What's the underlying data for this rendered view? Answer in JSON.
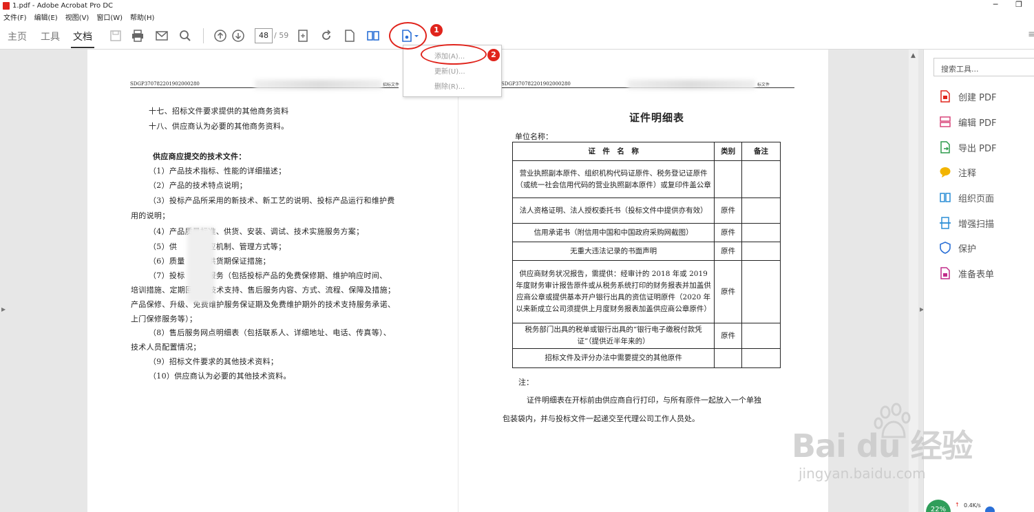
{
  "window": {
    "title": "1.pdf - Adobe Acrobat Pro DC",
    "minimize": "─",
    "restore": "❐"
  },
  "menu": [
    "文件(F)",
    "编辑(E)",
    "视图(V)",
    "窗口(W)",
    "帮助(H)"
  ],
  "tabs": {
    "home": "主页",
    "tools": "工具",
    "document": "文档"
  },
  "toolbar": {
    "page_current": "48",
    "page_total": "/ 59",
    "icons": [
      "save-icon",
      "print-icon",
      "email-icon",
      "search-icon",
      "page-up-icon",
      "page-down-icon",
      "fit-page-icon",
      "rotate-icon",
      "single-page-icon",
      "two-page-icon",
      "bookmark-dropdown-icon"
    ]
  },
  "dropdown": {
    "add": "添加(A)...",
    "update": "更新(U)...",
    "delete": "删除(R)..."
  },
  "annotations": {
    "badge1": "1",
    "badge2": "2"
  },
  "left_page": {
    "code": "SDGP370782201902000280",
    "header_tail": "招标文件",
    "lines": [
      "十七、招标文件要求提供的其他商务资料",
      "十八、供应商认为必要的其他商务资料。",
      "供应商应提交的技术文件：",
      "（1）产品技术指标、性能的详细描述；",
      "（2）产品的技术特点说明；",
      "（3）投标产品所采用的新技术、新工艺的说明、投标产品运行和维护费",
      "用的说明；",
      "（4）产品质量标准、供货、安装、调试、技术实施服务方案；",
      "（5）供　　　响应机制、管理方式等；",
      "（6）质量　　及供货期保证措施；",
      "（7）投标　　后服务（包括投标产品的免费保修期、维护响应时间、",
      "培训措施、定期回　　技术支持、售后服务内容、方式、流程、保障及措施；",
      "产品保修、升级、免费维护服务保证期及免费维护期外的技术支持服务承诺、",
      "上门保修服务等）；",
      "（8）售后服务网点明细表（包括联系人、详细地址、电话、传真等）、",
      "技术人员配置情况；",
      "（9）招标文件要求的其他技术资料；",
      "（10）供应商认为必要的其他技术资料。"
    ]
  },
  "right_page": {
    "code": "SDGP370782201902000280",
    "header_tail": "标文件",
    "title": "证件明细表",
    "unit_label": "单位名称：",
    "table": {
      "headers": [
        "证　件　名　称",
        "类别",
        "备注"
      ],
      "rows": [
        [
          "营业执照副本原件、组织机构代码证原件、税务登记证原件（或统一社会信用代码的营业执照副本原件）或复印件盖公章",
          "",
          ""
        ],
        [
          "法人资格证明、法人授权委托书（投标文件中提供亦有效）",
          "原件",
          ""
        ],
        [
          "信用承诺书（附信用中国和中国政府采购网截图）",
          "原件",
          ""
        ],
        [
          "无重大违法记录的书面声明",
          "原件",
          ""
        ],
        [
          "供应商财务状况报告，需提供：经审计的 2018 年或 2019 年度财务审计报告原件或从税务系统打印的财务报表并加盖供应商公章或提供基本开户银行出具的资信证明原件（2020 年以来新成立公司须提供上月度财务报表加盖供应商公章原件）",
          "原件",
          ""
        ],
        [
          "税务部门出具的税单或银行出具的“银行电子缴税付款凭证”（提供近半年来的）",
          "原件",
          ""
        ],
        [
          "招标文件及评分办法中需要提交的其他原件",
          "",
          ""
        ]
      ]
    },
    "note_label": "注：",
    "note_line1": "证件明细表在开标前由供应商自行打印，与所有原件一起放入一个单独",
    "note_line2": "包装袋内，并与投标文件一起递交至代理公司工作人员处。"
  },
  "right_panel": {
    "search_placeholder": "搜索工具...",
    "tools": [
      {
        "label": "创建 PDF",
        "icon": "create-pdf-icon",
        "color": "#e0241c"
      },
      {
        "label": "编辑 PDF",
        "icon": "edit-pdf-icon",
        "color": "#d9457a"
      },
      {
        "label": "导出 PDF",
        "icon": "export-pdf-icon",
        "color": "#2b9a4a"
      },
      {
        "label": "注释",
        "icon": "comment-icon",
        "color": "#f2b400"
      },
      {
        "label": "组织页面",
        "icon": "organize-pages-icon",
        "color": "#2a8ed6"
      },
      {
        "label": "增强扫描",
        "icon": "enhance-scan-icon",
        "color": "#2a8ed6"
      },
      {
        "label": "保护",
        "icon": "protect-icon",
        "color": "#2a6fd6"
      },
      {
        "label": "准备表单",
        "icon": "prepare-form-icon",
        "color": "#c02c8a"
      }
    ]
  },
  "watermark": {
    "main": "Bai du 经验",
    "sub": "jingyan.baidu.com"
  },
  "status": {
    "percent": "22%",
    "speed": "0.4K/s"
  }
}
